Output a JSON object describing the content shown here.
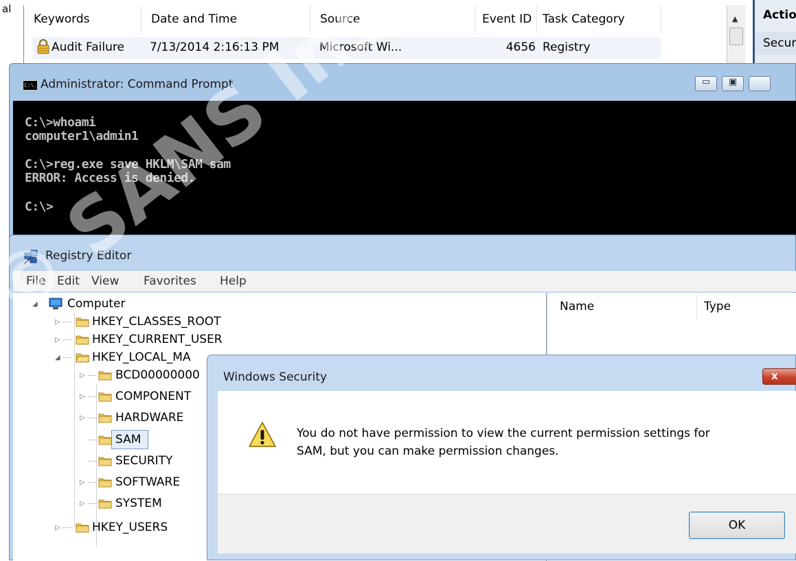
{
  "event_viewer": {
    "left_fragment": "al",
    "columns": [
      "Keywords",
      "Date and Time",
      "Source",
      "Event ID",
      "Task Category"
    ],
    "row": {
      "keywords": "Audit Failure",
      "date_time": "7/13/2014 2:16:13 PM",
      "source": "Microsoft Wi...",
      "event_id": "4656",
      "task_category": "Registry"
    },
    "actions_title": "Actio",
    "actions_item": "Secur"
  },
  "command_prompt": {
    "title": "Administrator: Command Prompt",
    "icon_text": "C:\\.",
    "lines": [
      "C:\\>whoami",
      "computer1\\admin1",
      "C:\\>reg.exe save HKLM\\SAM sam",
      "ERROR: Access is denied.",
      "C:\\>"
    ]
  },
  "registry_editor": {
    "title": "Registry Editor",
    "menu": [
      "File",
      "Edit",
      "View",
      "Favorites",
      "Help"
    ],
    "tree": {
      "root": "Computer",
      "hives": [
        "HKEY_CLASSES_ROOT",
        "HKEY_CURRENT_USER",
        "HKEY_LOCAL_MA",
        "HKEY_USERS"
      ],
      "hklm_children": [
        "BCD00000000",
        "COMPONENT",
        "HARDWARE",
        "SAM",
        "SECURITY",
        "SOFTWARE",
        "SYSTEM"
      ],
      "selected": "SAM"
    },
    "columns": [
      "Name",
      "Type"
    ]
  },
  "security_dialog": {
    "title": "Windows Security",
    "close_label": "x",
    "message_line1": "You do not have permission to view the current permission settings for",
    "message_line2": "SAM, but you can make permission changes.",
    "ok_label": "OK"
  },
  "watermark": "© SANS Institute, Author"
}
